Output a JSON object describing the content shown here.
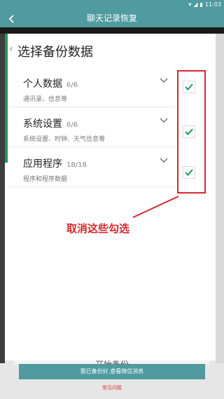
{
  "status_bar": {
    "time": "11:03"
  },
  "app_bar": {
    "title": "聊天记录恢复",
    "back_icon": "arrow-left-icon"
  },
  "dialog": {
    "title": "选择备份数据",
    "items": [
      {
        "name": "个人数据",
        "count": "6/6",
        "desc": "通讯录、信息等",
        "checked": true
      },
      {
        "name": "系统设置",
        "count": "6/6",
        "desc": "系统设置、时钟、天气信息等",
        "checked": true
      },
      {
        "name": "应用程序",
        "count": "18/18",
        "desc": "程序和程序数据",
        "checked": true
      }
    ]
  },
  "annotation": {
    "text": "取消这些勾选",
    "color": "#d4282d"
  },
  "background": {
    "start_button_label": "开始备份",
    "cyan_button_label": "我已备份好,查看微信消息",
    "faq_label": "常见问题"
  },
  "colors": {
    "accent": "#4f9ba0",
    "check": "#1a9a5a",
    "annotation": "#d4282d"
  }
}
